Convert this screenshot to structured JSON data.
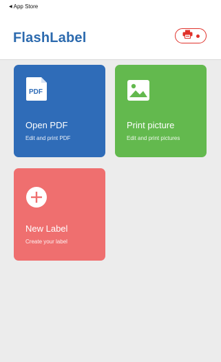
{
  "status_bar": {
    "back_label": "App Store",
    "back_glyph": "◀"
  },
  "header": {
    "title": "FlashLabel",
    "printer_icon": "printer-icon"
  },
  "cards": {
    "pdf": {
      "title": "Open PDF",
      "subtitle": "Edit and print PDF",
      "icon_text": "PDF",
      "icon": "pdf-file-icon",
      "color": "#2f6cb8"
    },
    "picture": {
      "title": "Print picture",
      "subtitle": "Edit and print pictures",
      "icon": "image-icon",
      "color": "#63b94e"
    },
    "new_label": {
      "title": "New Label",
      "subtitle": "Create your label",
      "icon": "plus-circle-icon",
      "color": "#ef6f6f"
    }
  },
  "colors": {
    "brand_title": "#2c6aae",
    "accent_red": "#e0312a",
    "background": "#ececec"
  }
}
